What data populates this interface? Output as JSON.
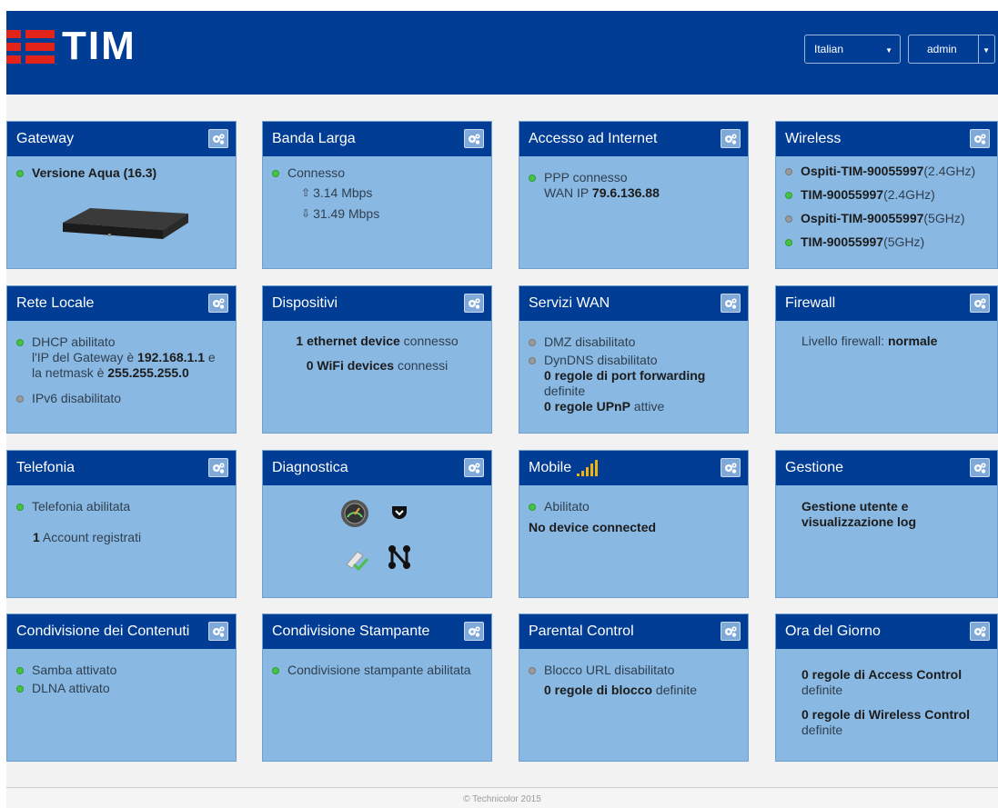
{
  "header": {
    "logo_text": "TIM",
    "language": "Italian",
    "user": "admin"
  },
  "cards": {
    "gateway": {
      "title": "Gateway",
      "version": "Versione Aqua (16.3)"
    },
    "broadband": {
      "title": "Banda Larga",
      "status": "Connesso",
      "up": "3.14 Mbps",
      "down": "31.49 Mbps"
    },
    "internet": {
      "title": "Accesso ad Internet",
      "status": "PPP connesso",
      "wan_label": "WAN IP ",
      "wan_ip": "79.6.136.88"
    },
    "wireless": {
      "title": "Wireless",
      "networks": [
        {
          "name": "Ospiti-TIM-90055997",
          "band": "(2.4GHz)"
        },
        {
          "name": "TIM-90055997",
          "band": "(2.4GHz)"
        },
        {
          "name": "Ospiti-TIM-90055997",
          "band": "(5GHz)"
        },
        {
          "name": "TIM-90055997",
          "band": "(5GHz)"
        }
      ]
    },
    "lan": {
      "title": "Rete Locale",
      "dhcp": "DHCP abilitato",
      "ip_prefix": "l'IP del Gateway è ",
      "ip": "192.168.1.1",
      "ip_suffix": " e la netmask è ",
      "netmask": "255.255.255.0",
      "ipv6": "IPv6 disabilitato"
    },
    "devices": {
      "title": "Dispositivi",
      "eth_bold": "1 ethernet device",
      "eth_rest": " connesso",
      "wifi_bold": "0 WiFi devices",
      "wifi_rest": " connessi"
    },
    "wan_services": {
      "title": "Servizi WAN",
      "dmz": "DMZ disabilitato",
      "dyndns": "DynDNS disabilitato",
      "pf_bold": "0 regole di port forwarding",
      "pf_rest": " definite",
      "upnp_bold": "0 regole UPnP",
      "upnp_rest": " attive"
    },
    "firewall": {
      "title": "Firewall",
      "label": "Livello firewall: ",
      "level": "normale"
    },
    "telephony": {
      "title": "Telefonia",
      "status": "Telefonia abilitata",
      "accounts_bold": "1",
      "accounts_rest": " Account registrati"
    },
    "diagnostics": {
      "title": "Diagnostica"
    },
    "mobile": {
      "title": "Mobile",
      "status": "Abilitato",
      "device": "No device connected"
    },
    "management": {
      "title": "Gestione",
      "text": "Gestione utente e visualizzazione log"
    },
    "sharing": {
      "title": "Condivisione dei Contenuti",
      "samba": "Samba attivato",
      "dlna": "DLNA attivato"
    },
    "printer": {
      "title": "Condivisione Stampante",
      "status": "Condivisione stampante abilitata"
    },
    "parental": {
      "title": "Parental Control",
      "url": "Blocco URL disabilitato",
      "rules_bold": "0 regole di blocco",
      "rules_rest": " definite"
    },
    "tod": {
      "title": "Ora del Giorno",
      "ac_bold": "0 regole di Access Control",
      "ac_rest": "definite",
      "wc_bold": "0 regole di Wireless Control",
      "wc_rest": "definite"
    }
  },
  "footer": {
    "text": "© Technicolor 2015"
  },
  "colors": {
    "brand_blue": "#013d95",
    "card_bg": "#89b8e2",
    "logo_red": "#e2231a",
    "status_green": "#47c247",
    "status_grey": "#9a9a9a"
  }
}
